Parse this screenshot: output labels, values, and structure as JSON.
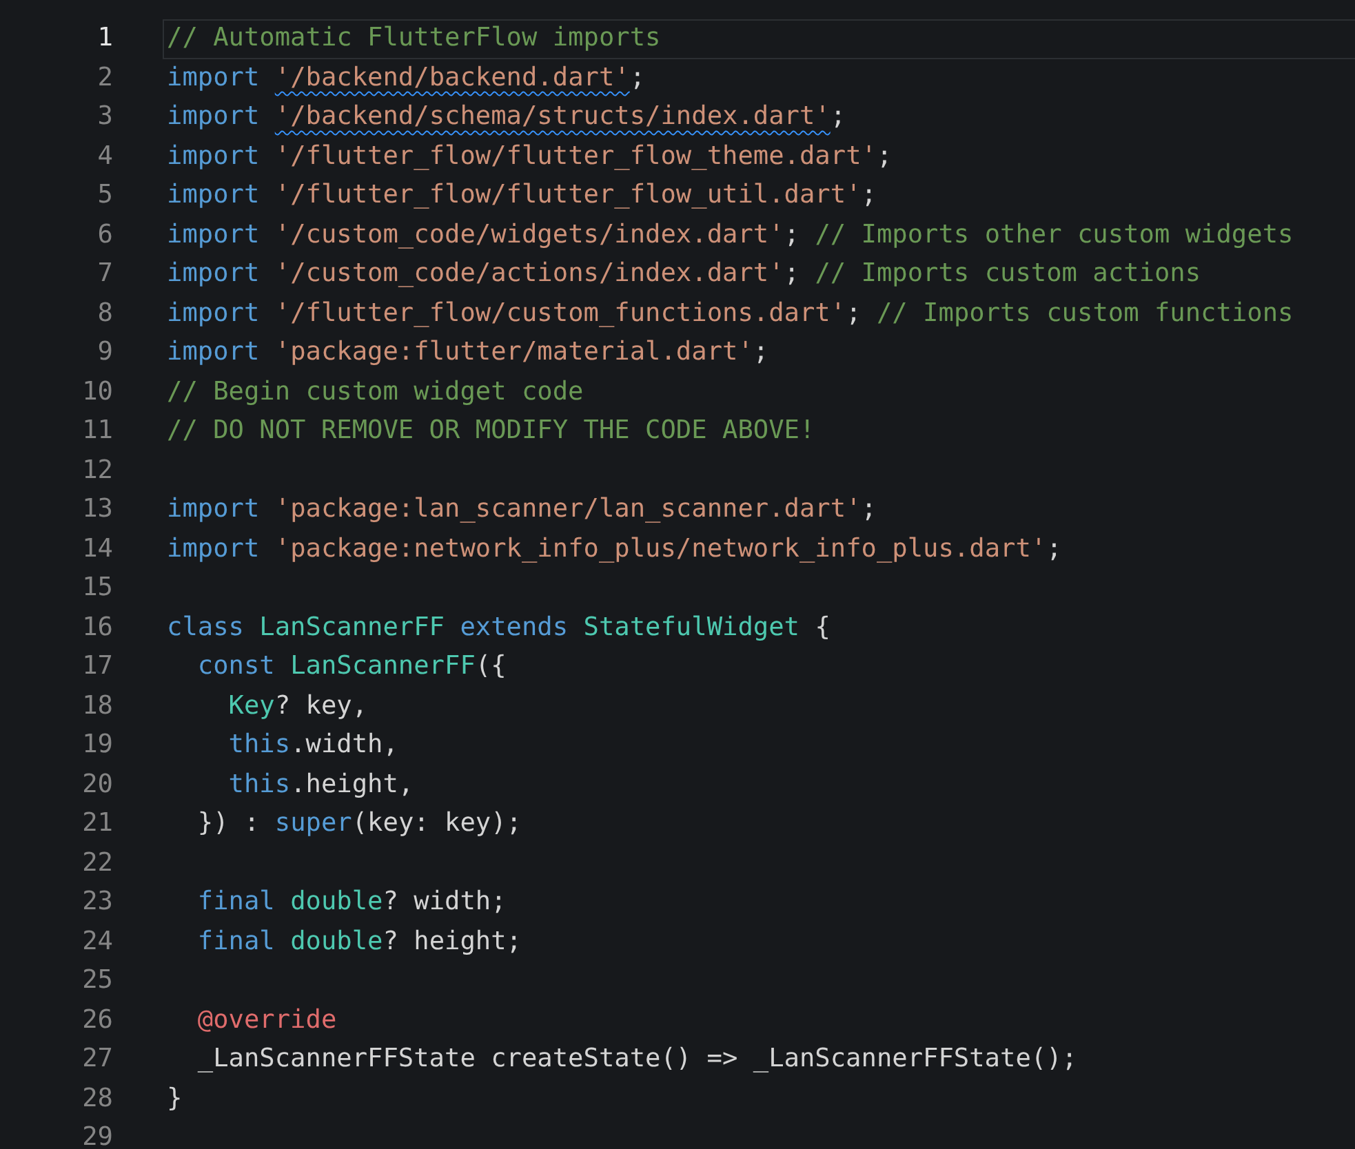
{
  "editor": {
    "lines": [
      {
        "number": "1",
        "current": true,
        "tokens": [
          {
            "kind": "comment",
            "text": "// Automatic FlutterFlow imports"
          }
        ]
      },
      {
        "number": "2",
        "current": false,
        "tokens": [
          {
            "kind": "keyword",
            "text": "import "
          },
          {
            "kind": "string",
            "text": "'/backend/backend.dart'",
            "warning": true
          },
          {
            "kind": "plain",
            "text": ";"
          }
        ]
      },
      {
        "number": "3",
        "current": false,
        "tokens": [
          {
            "kind": "keyword",
            "text": "import "
          },
          {
            "kind": "string",
            "text": "'/backend/schema/structs/index.dart'",
            "warning": true
          },
          {
            "kind": "plain",
            "text": ";"
          }
        ]
      },
      {
        "number": "4",
        "current": false,
        "tokens": [
          {
            "kind": "keyword",
            "text": "import "
          },
          {
            "kind": "string",
            "text": "'/flutter_flow/flutter_flow_theme.dart'"
          },
          {
            "kind": "plain",
            "text": ";"
          }
        ]
      },
      {
        "number": "5",
        "current": false,
        "tokens": [
          {
            "kind": "keyword",
            "text": "import "
          },
          {
            "kind": "string",
            "text": "'/flutter_flow/flutter_flow_util.dart'"
          },
          {
            "kind": "plain",
            "text": ";"
          }
        ]
      },
      {
        "number": "6",
        "current": false,
        "tokens": [
          {
            "kind": "keyword",
            "text": "import "
          },
          {
            "kind": "string",
            "text": "'/custom_code/widgets/index.dart'"
          },
          {
            "kind": "plain",
            "text": "; "
          },
          {
            "kind": "comment",
            "text": "// Imports other custom widgets"
          }
        ]
      },
      {
        "number": "7",
        "current": false,
        "tokens": [
          {
            "kind": "keyword",
            "text": "import "
          },
          {
            "kind": "string",
            "text": "'/custom_code/actions/index.dart'"
          },
          {
            "kind": "plain",
            "text": "; "
          },
          {
            "kind": "comment",
            "text": "// Imports custom actions"
          }
        ]
      },
      {
        "number": "8",
        "current": false,
        "tokens": [
          {
            "kind": "keyword",
            "text": "import "
          },
          {
            "kind": "string",
            "text": "'/flutter_flow/custom_functions.dart'"
          },
          {
            "kind": "plain",
            "text": "; "
          },
          {
            "kind": "comment",
            "text": "// Imports custom functions"
          }
        ]
      },
      {
        "number": "9",
        "current": false,
        "tokens": [
          {
            "kind": "keyword",
            "text": "import "
          },
          {
            "kind": "string",
            "text": "'package:flutter/material.dart'"
          },
          {
            "kind": "plain",
            "text": ";"
          }
        ]
      },
      {
        "number": "10",
        "current": false,
        "tokens": [
          {
            "kind": "comment",
            "text": "// Begin custom widget code"
          }
        ]
      },
      {
        "number": "11",
        "current": false,
        "tokens": [
          {
            "kind": "comment",
            "text": "// DO NOT REMOVE OR MODIFY THE CODE ABOVE!"
          }
        ]
      },
      {
        "number": "12",
        "current": false
      },
      {
        "number": "13",
        "current": false,
        "tokens": [
          {
            "kind": "keyword",
            "text": "import "
          },
          {
            "kind": "string",
            "text": "'package:lan_scanner/lan_scanner.dart'"
          },
          {
            "kind": "plain",
            "text": ";"
          }
        ]
      },
      {
        "number": "14",
        "current": false,
        "tokens": [
          {
            "kind": "keyword",
            "text": "import "
          },
          {
            "kind": "string",
            "text": "'package:network_info_plus/network_info_plus.dart'"
          },
          {
            "kind": "plain",
            "text": ";"
          }
        ]
      },
      {
        "number": "15",
        "current": false
      },
      {
        "number": "16",
        "current": false,
        "tokens": [
          {
            "kind": "keyword",
            "text": "class "
          },
          {
            "kind": "type",
            "text": "LanScannerFF"
          },
          {
            "kind": "keyword",
            "text": " extends "
          },
          {
            "kind": "type",
            "text": "StatefulWidget"
          },
          {
            "kind": "plain",
            "text": " {"
          }
        ]
      },
      {
        "number": "17",
        "current": false,
        "tokens": [
          {
            "kind": "keyword",
            "text": "  const "
          },
          {
            "kind": "type",
            "text": "LanScannerFF"
          },
          {
            "kind": "plain",
            "text": "({"
          }
        ]
      },
      {
        "number": "18",
        "current": false,
        "tokens": [
          {
            "kind": "type",
            "text": "    Key"
          },
          {
            "kind": "plain",
            "text": "? key,"
          }
        ]
      },
      {
        "number": "19",
        "current": false,
        "tokens": [
          {
            "kind": "keyword",
            "text": "    this"
          },
          {
            "kind": "plain",
            "text": ".width,"
          }
        ]
      },
      {
        "number": "20",
        "current": false,
        "tokens": [
          {
            "kind": "keyword",
            "text": "    this"
          },
          {
            "kind": "plain",
            "text": ".height,"
          }
        ]
      },
      {
        "number": "21",
        "current": false,
        "tokens": [
          {
            "kind": "plain",
            "text": "  }) : "
          },
          {
            "kind": "keyword",
            "text": "super"
          },
          {
            "kind": "plain",
            "text": "(key: key);"
          }
        ]
      },
      {
        "number": "22",
        "current": false
      },
      {
        "number": "23",
        "current": false,
        "tokens": [
          {
            "kind": "keyword",
            "text": "  final "
          },
          {
            "kind": "type",
            "text": "double"
          },
          {
            "kind": "plain",
            "text": "? width;"
          }
        ]
      },
      {
        "number": "24",
        "current": false,
        "tokens": [
          {
            "kind": "keyword",
            "text": "  final "
          },
          {
            "kind": "type",
            "text": "double"
          },
          {
            "kind": "plain",
            "text": "? height;"
          }
        ]
      },
      {
        "number": "25",
        "current": false
      },
      {
        "number": "26",
        "current": false,
        "tokens": [
          {
            "kind": "annotation",
            "text": "  @override"
          }
        ]
      },
      {
        "number": "27",
        "current": false,
        "tokens": [
          {
            "kind": "plain",
            "text": "  _LanScannerFFState createState() => _LanScannerFFState();"
          }
        ]
      },
      {
        "number": "28",
        "current": false,
        "tokens": [
          {
            "kind": "plain",
            "text": "}"
          }
        ]
      },
      {
        "number": "29",
        "current": false
      }
    ]
  }
}
